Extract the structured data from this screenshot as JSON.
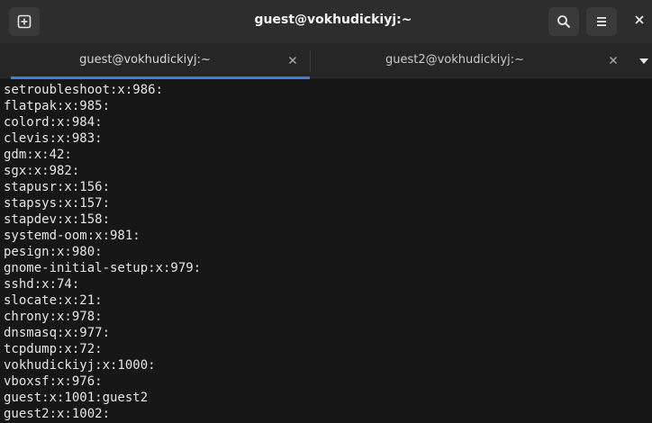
{
  "window": {
    "title": "guest@vokhudickiyj:~"
  },
  "headerbar": {
    "new_tab_icon": "new-tab-icon",
    "search_icon": "search-icon",
    "menu_icon": "hamburger-menu-icon",
    "close_icon": "close-icon"
  },
  "tabs": [
    {
      "label": "guest@vokhudickiyj:~",
      "active": true
    },
    {
      "label": "guest2@vokhudickiyj:~",
      "active": false
    }
  ],
  "colors": {
    "accent": "#3584e4",
    "terminal_bg": "#171717",
    "terminal_fg": "#e6e6e6"
  },
  "terminal": {
    "lines": [
      "setroubleshoot:x:986:",
      "flatpak:x:985:",
      "colord:x:984:",
      "clevis:x:983:",
      "gdm:x:42:",
      "sgx:x:982:",
      "stapusr:x:156:",
      "stapsys:x:157:",
      "stapdev:x:158:",
      "systemd-oom:x:981:",
      "pesign:x:980:",
      "gnome-initial-setup:x:979:",
      "sshd:x:74:",
      "slocate:x:21:",
      "chrony:x:978:",
      "dnsmasq:x:977:",
      "tcpdump:x:72:",
      "vokhudickiyj:x:1000:",
      "vboxsf:x:976:",
      "guest:x:1001:guest2",
      "guest2:x:1002:"
    ]
  }
}
